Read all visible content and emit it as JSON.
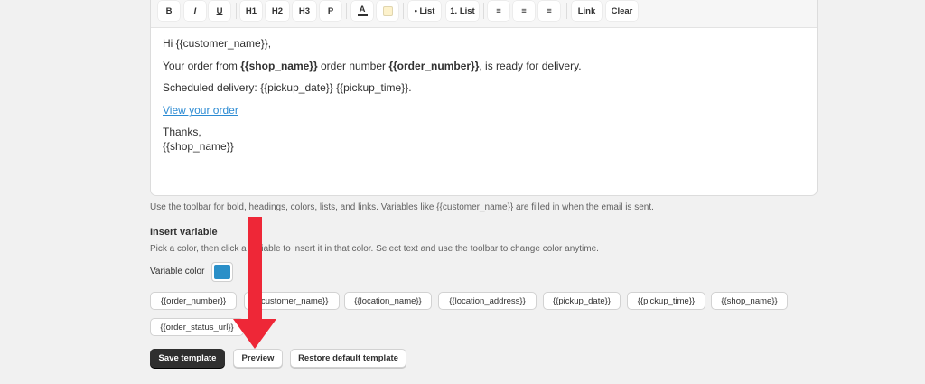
{
  "toolbar": {
    "bold": "B",
    "italic": "I",
    "underline": "U",
    "h1": "H1",
    "h2": "H2",
    "h3": "H3",
    "paragraph": "P",
    "text_color": "A",
    "bullet_list": "• List",
    "numbered_list": "1. List",
    "align_left": "≡",
    "align_center": "≡",
    "align_right": "≡",
    "link": "Link",
    "clear": "Clear"
  },
  "email_body": {
    "greeting": "Hi {{customer_name}},",
    "line1_a": "Your order from ",
    "line1_b": "{{shop_name}}",
    "line1_c": " order number ",
    "line1_d": "{{order_number}}",
    "line1_e": ", is ready for delivery.",
    "line2": "Scheduled delivery: {{pickup_date}} {{pickup_time}}.",
    "link_text": "View your order",
    "thanks": "Thanks,",
    "signature": "{{shop_name}}"
  },
  "help_text": "Use the toolbar for bold, headings, colors, lists, and links. Variables like {{customer_name}} are filled in when the email is sent.",
  "insert_variable": {
    "title": "Insert variable",
    "description": "Pick a color, then click a variable to insert it in that color. Select text and use the toolbar to change color anytime.",
    "color_label": "Variable color",
    "color_value": "#2a8fc8",
    "variables": [
      "{{order_number}}",
      "{{customer_name}}",
      "{{location_name}}",
      "{{location_address}}",
      "{{pickup_date}}",
      "{{pickup_time}}",
      "{{shop_name}}",
      "{{order_status_url}}"
    ]
  },
  "actions": {
    "save": "Save template",
    "preview": "Preview",
    "restore": "Restore default template"
  },
  "colors": {
    "link": "#2c8bd3",
    "primary_button": "#2f2f2f",
    "annotation_arrow": "#ee2737"
  }
}
